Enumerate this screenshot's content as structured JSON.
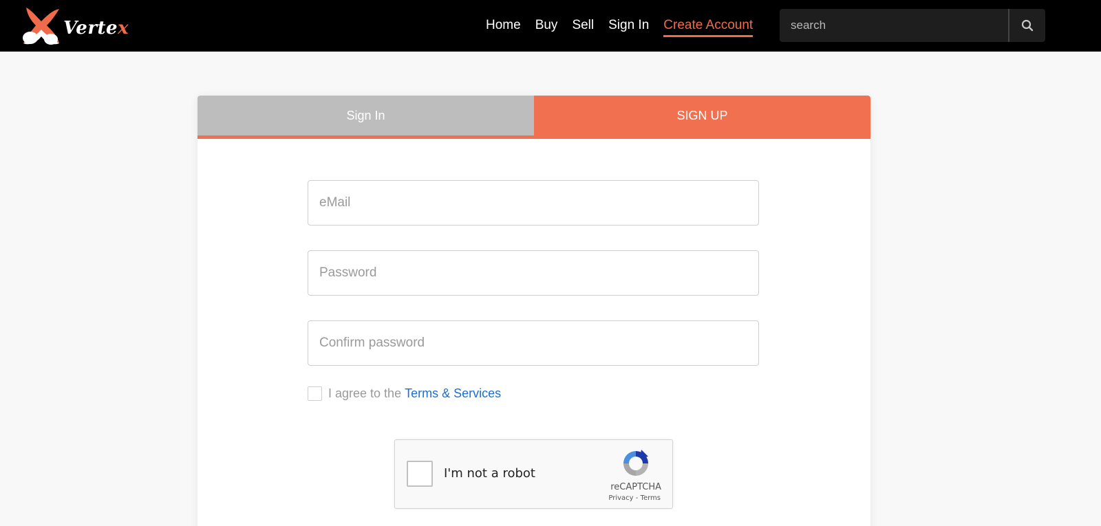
{
  "header": {
    "brand_prefix": "Verte",
    "brand_suffix": "x",
    "nav": [
      {
        "label": "Home",
        "active": false
      },
      {
        "label": "Buy",
        "active": false
      },
      {
        "label": "Sell",
        "active": false
      },
      {
        "label": "Sign In",
        "active": false
      },
      {
        "label": "Create Account",
        "active": true
      }
    ],
    "search_placeholder": "search"
  },
  "tabs": {
    "sign_in": "Sign In",
    "sign_up": "SIGN UP"
  },
  "form": {
    "email_placeholder": "eMail",
    "password_placeholder": "Password",
    "confirm_placeholder": "Confirm password",
    "agree_text": "I agree to the",
    "terms_link": "Terms & Services"
  },
  "captcha": {
    "label": "I'm not a robot",
    "brand": "reCAPTCHA",
    "links": "Privacy - Terms"
  },
  "colors": {
    "accent": "#f07050",
    "header_bg": "#000000",
    "link_blue": "#1a6fd1"
  }
}
